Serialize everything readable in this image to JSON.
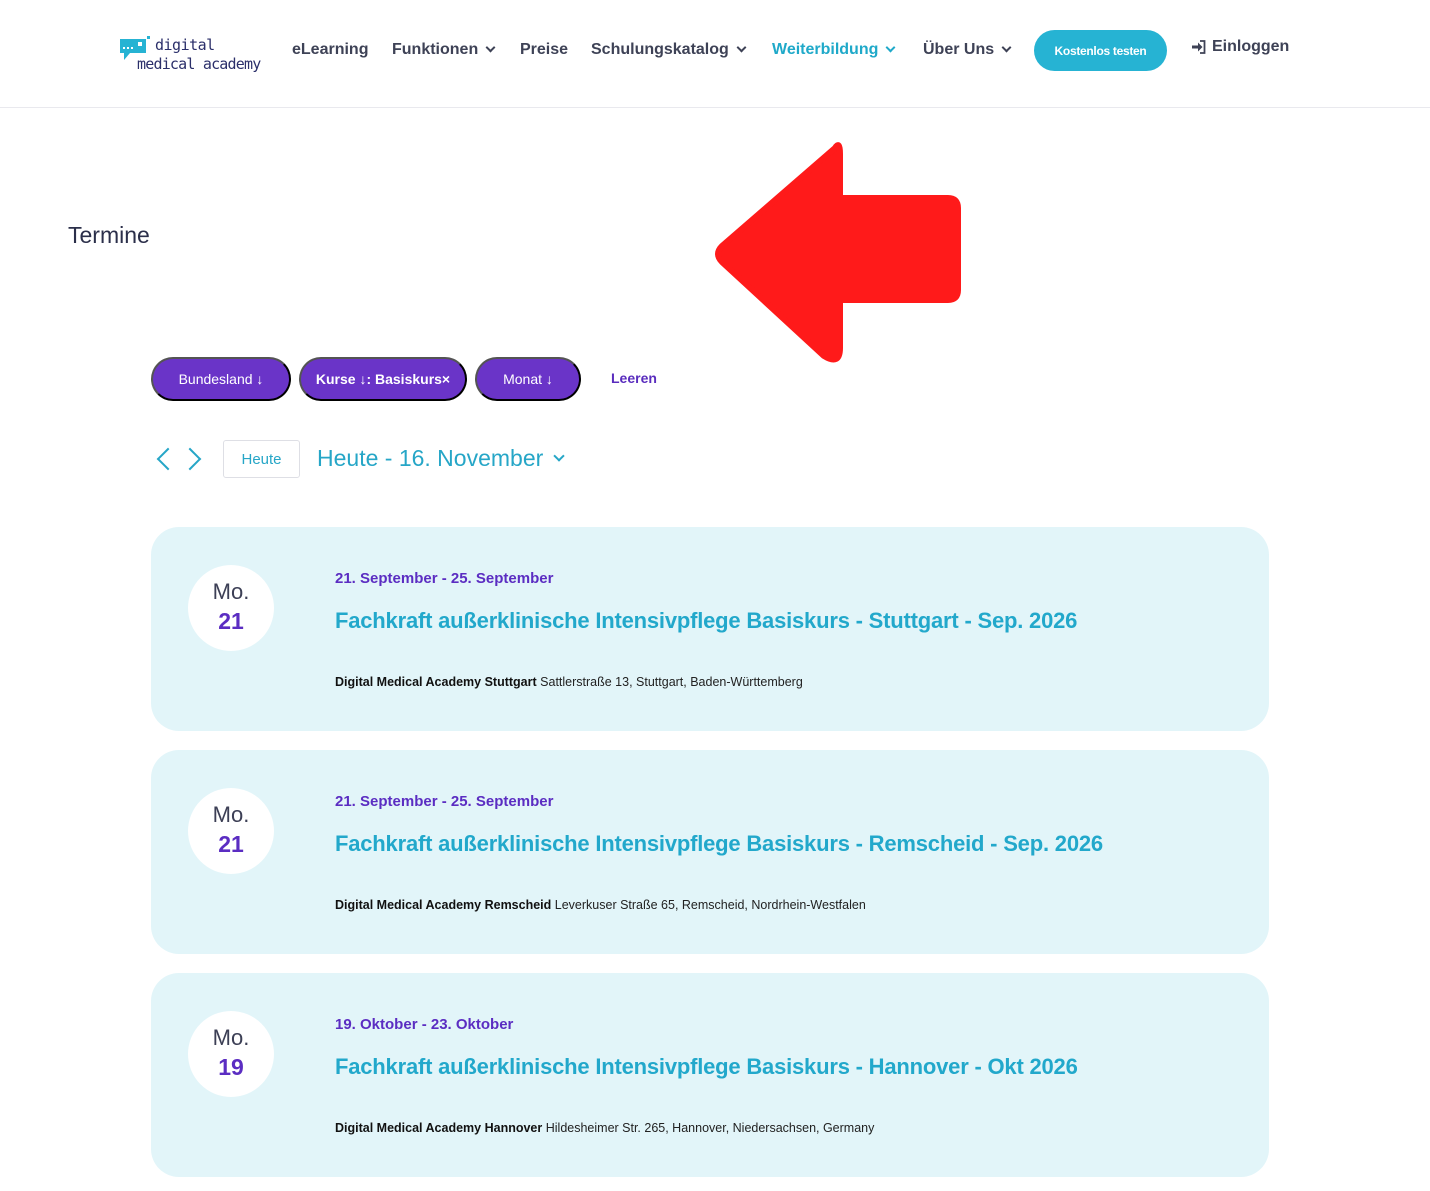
{
  "header": {
    "logo": {
      "line1": "digital",
      "line2": "medical academy"
    },
    "nav": [
      {
        "label": "eLearning",
        "dropdown": false,
        "active": false
      },
      {
        "label": "Funktionen",
        "dropdown": true,
        "active": false
      },
      {
        "label": "Preise",
        "dropdown": false,
        "active": false
      },
      {
        "label": "Schulungskatalog",
        "dropdown": true,
        "active": false
      },
      {
        "label": "Weiterbildung",
        "dropdown": true,
        "active": true
      },
      {
        "label": "Über Uns",
        "dropdown": true,
        "active": false
      }
    ],
    "cta_label": "Kostenlos testen",
    "login_label": "Einloggen"
  },
  "page": {
    "title": "Termine"
  },
  "filters": {
    "items": [
      {
        "label": "Bundesland ↓"
      },
      {
        "label": "Kurse ↓: Basiskurs×"
      },
      {
        "label": "Monat ↓"
      }
    ],
    "clear_label": "Leeren"
  },
  "calendar": {
    "today_label": "Heute",
    "range_label": "Heute - 16. November"
  },
  "events": [
    {
      "day": "Mo.",
      "date": "21",
      "range": "21. September - 25. September",
      "title": "Fachkraft außerklinische Intensivpflege Basiskurs - Stuttgart - Sep. 2026",
      "venue": "Digital Medical Academy Stuttgart",
      "address": "Sattlerstraße 13, Stuttgart, Baden-Württemberg"
    },
    {
      "day": "Mo.",
      "date": "21",
      "range": "21. September - 25. September",
      "title": "Fachkraft außerklinische Intensivpflege Basiskurs - Remscheid - Sep. 2026",
      "venue": "Digital Medical Academy Remscheid",
      "address": "Leverkuser Straße 65, Remscheid, Nordrhein-Westfalen"
    },
    {
      "day": "Mo.",
      "date": "19",
      "range": "19. Oktober - 23. Oktober",
      "title": "Fachkraft außerklinische Intensivpflege Basiskurs - Hannover - Okt 2026",
      "venue": "Digital Medical Academy Hannover",
      "address": "Hildesheimer Str. 265, Hannover, Niedersachsen, Germany"
    }
  ],
  "colors": {
    "accent_teal": "#26b3d3",
    "accent_purple": "#6a34c8",
    "card_bg": "#e2f5f9",
    "annotation_arrow": "#ff1a1a"
  }
}
